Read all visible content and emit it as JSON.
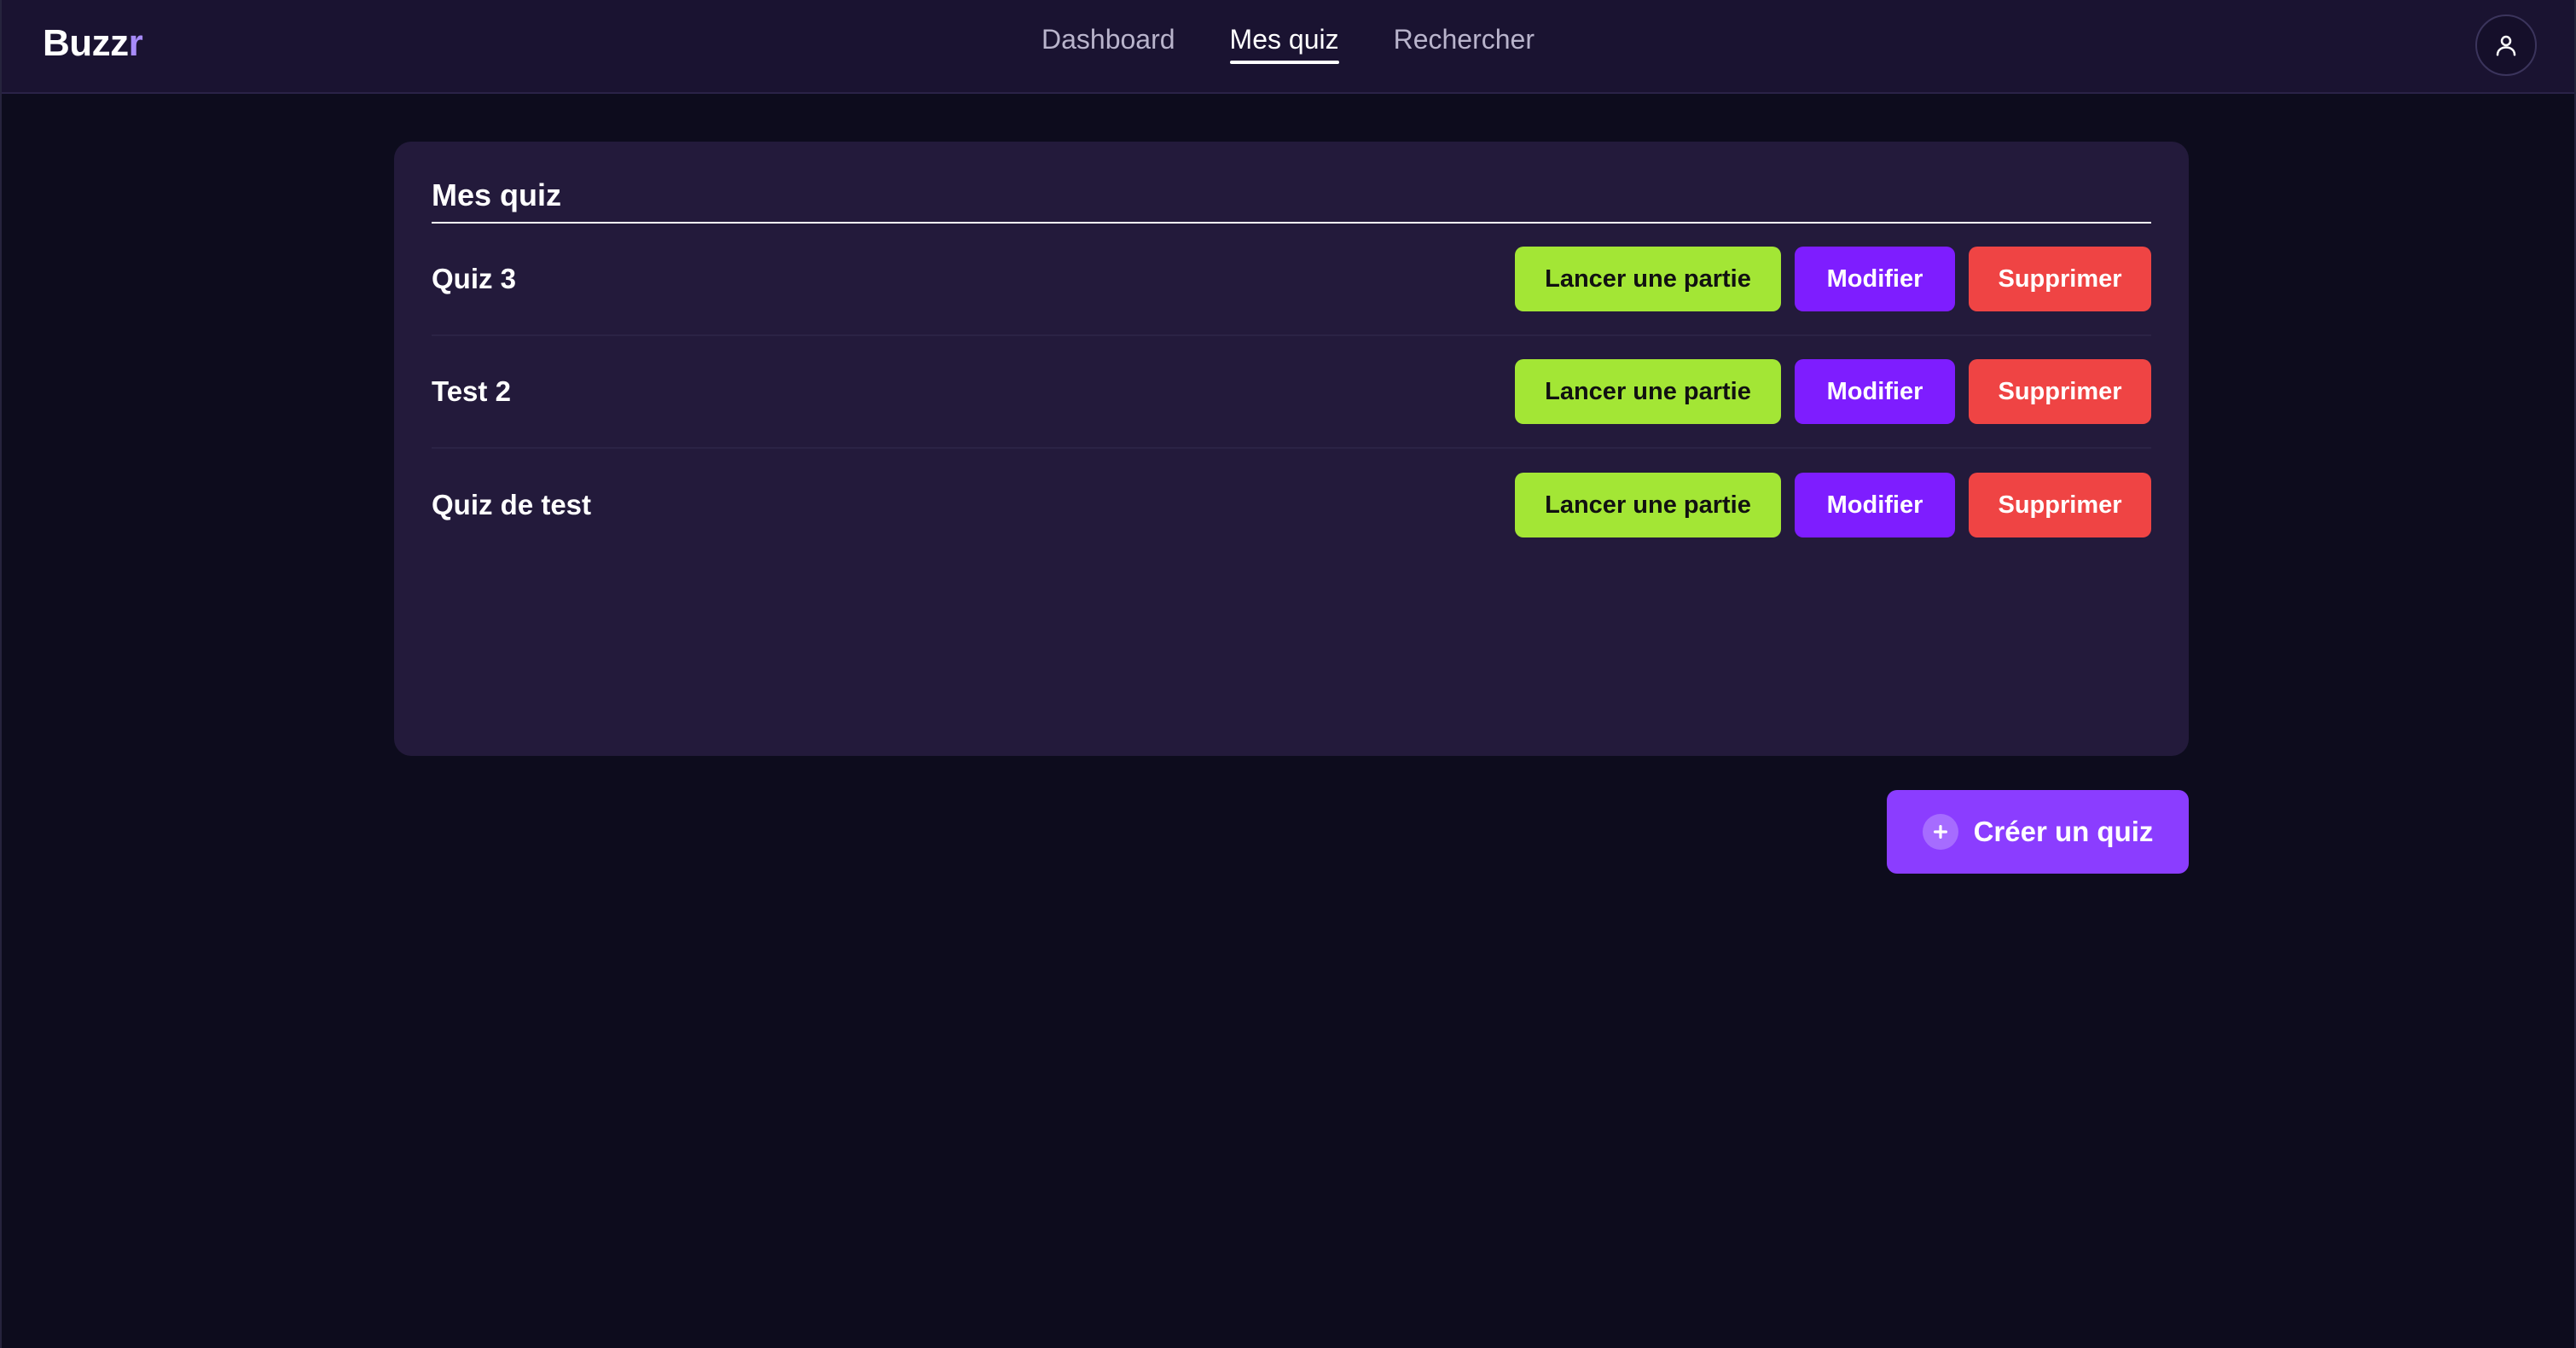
{
  "app": {
    "logo_main": "Buzz",
    "logo_accent": "r",
    "accent_color": "#a78bfa"
  },
  "nav": {
    "items": [
      {
        "label": "Dashboard",
        "active": false
      },
      {
        "label": "Mes quiz",
        "active": true
      },
      {
        "label": "Rechercher",
        "active": false
      }
    ]
  },
  "user": {
    "avatar_icon": "user-icon"
  },
  "panel": {
    "title": "Mes quiz"
  },
  "quizzes": [
    {
      "name": "Quiz 3",
      "launch_label": "Lancer une partie",
      "edit_label": "Modifier",
      "delete_label": "Supprimer"
    },
    {
      "name": "Test 2",
      "launch_label": "Lancer une partie",
      "edit_label": "Modifier",
      "delete_label": "Supprimer"
    },
    {
      "name": "Quiz de test",
      "launch_label": "Lancer une partie",
      "edit_label": "Modifier",
      "delete_label": "Supprimer"
    }
  ],
  "create_button": {
    "label": "Créer un quiz",
    "icon": "plus-circle-icon"
  },
  "colors": {
    "background": "#0d0c1d",
    "topbar": "#1a1331",
    "panel": "#231a3b",
    "launch": "#a3e635",
    "edit": "#7e1dff",
    "delete": "#ef4444",
    "create": "#8b3dff"
  }
}
